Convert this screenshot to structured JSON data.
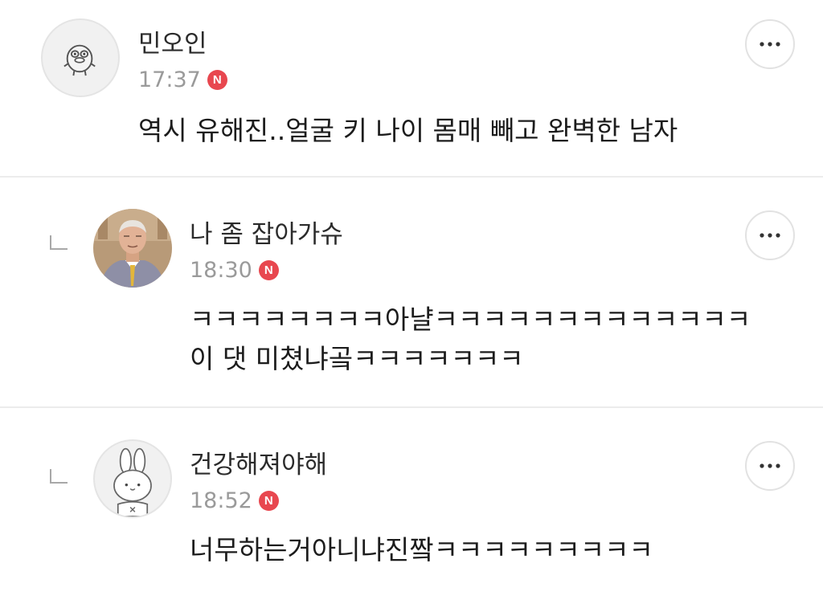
{
  "comments": [
    {
      "username": "민오인",
      "time": "17:37",
      "badge": "N",
      "lines": [
        "역시 유해진..얼굴 키 나이 몸매 빼고 완벽한 남자"
      ],
      "avatar_icon": "duck-character-icon"
    },
    {
      "username": "나 좀 잡아가슈",
      "time": "18:30",
      "badge": "N",
      "lines": [
        "ㅋㅋㅋㅋㅋㅋㅋㅋ아냘ㅋㅋㅋㅋㅋㅋㅋㅋㅋㅋㅋㅋㅋ",
        "이 댓 미쳤냐곸ㅋㅋㅋㅋㅋㅋㅋ"
      ],
      "avatar_icon": "elderly-man-photo"
    },
    {
      "username": "건강해져야해",
      "time": "18:52",
      "badge": "N",
      "lines": [
        "너무하는거아니냐진짴ㅋㅋㅋㅋㅋㅋㅋㅋㅋ"
      ],
      "avatar_icon": "rabbit-character-icon"
    }
  ],
  "colors": {
    "badge": "#e8474f",
    "time": "#9a9a9a",
    "divider": "#ececec"
  }
}
